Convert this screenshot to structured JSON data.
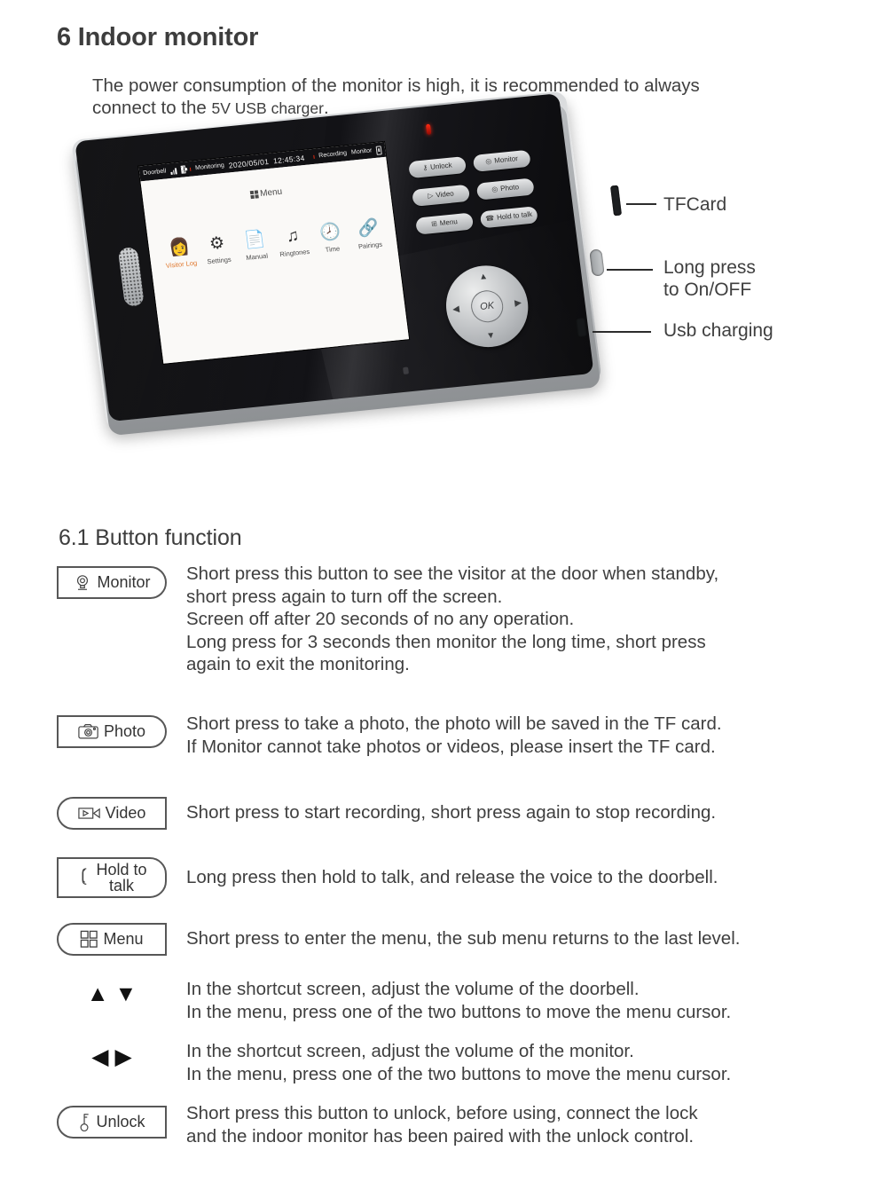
{
  "doc": {
    "section_number_title": "6 Indoor monitor",
    "intro_line1": "The power consumption of the monitor is high, it is recommended to always",
    "intro_line2_a": "connect to the ",
    "intro_line2_small": "5V USB",
    "intro_line2_b": " charger",
    "intro_line2_end": ".",
    "subsection_title": "6.1  Button function"
  },
  "device": {
    "callouts": [
      {
        "label": "TFCard"
      },
      {
        "label": "Long press\nto On/OFF"
      },
      {
        "label": "Usb charging"
      }
    ],
    "screen": {
      "status": {
        "name": "Doorbell",
        "monitoring": "Monitoring",
        "date": "2020/05/01",
        "time": "12:45:34",
        "recording": "Recording",
        "monitor": "Monitor",
        "card_icon": "sd-card-icon"
      },
      "menu_title": "Menu",
      "menu_items": [
        {
          "label": "Visitor Log",
          "icon": "visitor-person-icon",
          "glyph": "👩",
          "active": true
        },
        {
          "label": "Settings",
          "icon": "gear-icon",
          "glyph": "⚙",
          "active": false
        },
        {
          "label": "Manual",
          "icon": "document-icon",
          "glyph": "📄",
          "active": false
        },
        {
          "label": "Ringtones",
          "icon": "music-note-icon",
          "glyph": "♫",
          "active": false
        },
        {
          "label": "Time",
          "icon": "clock-icon",
          "glyph": "🕗",
          "active": false
        },
        {
          "label": "Pairings",
          "icon": "chain-link-icon",
          "glyph": "🔗",
          "active": false
        }
      ]
    },
    "keys": [
      {
        "label": "Unlock",
        "icon": "key-icon",
        "glyph": "⚷"
      },
      {
        "label": "Monitor",
        "icon": "camera-icon",
        "glyph": "◎"
      },
      {
        "label": "Video",
        "icon": "video-icon",
        "glyph": "▷"
      },
      {
        "label": "Photo",
        "icon": "photo-icon",
        "glyph": "◎"
      },
      {
        "label": "Menu",
        "icon": "grid-icon",
        "glyph": "⊞"
      },
      {
        "label": "Hold\nto talk",
        "icon": "handset-icon",
        "glyph": "☎"
      }
    ],
    "dpad": {
      "ok": "OK",
      "up": "▲",
      "down": "▼",
      "left": "◀",
      "right": "▶"
    }
  },
  "button_functions": [
    {
      "badge_label": "Monitor",
      "icon": "camera-monitor-icon",
      "shape": "r-right",
      "description": "Short press this button to see the visitor at the door when standby,\nshort press again to turn off  the screen.\nScreen off after 20 seconds of no any operation.\nLong press for 3 seconds then monitor the long time, short press\nagain to exit the monitoring."
    },
    {
      "badge_label": "Photo",
      "icon": "camera-icon",
      "shape": "r-right",
      "description": "Short press to take a photo, the photo will be saved in the TF card.\nIf Monitor cannot take photos or videos, please insert the TF card."
    },
    {
      "badge_label": "Video",
      "icon": "video-camera-icon",
      "shape": "r-left",
      "description": "Short press to start recording,  short press again to stop recording."
    },
    {
      "badge_label": "Hold to\ntalk",
      "icon": "phone-handset-icon",
      "shape": "r-right",
      "description": "Long  press then hold to talk, and release the voice to the doorbell."
    },
    {
      "badge_label": "Menu",
      "icon": "grid-menu-icon",
      "shape": "r-left",
      "description": "Short press to enter the menu, the sub menu returns to the last level."
    },
    {
      "badge_label": "",
      "icon": "up-down-arrows-icon",
      "shape": "arrows-vertical",
      "glyphs": "▲ ▼",
      "description": "In the shortcut screen, adjust the volume of the doorbell.\nIn the menu, press one of the two buttons to move the menu cursor."
    },
    {
      "badge_label": "",
      "icon": "left-right-arrows-icon",
      "shape": "arrows-horizontal",
      "glyphs": "◀ ▶",
      "description": "In the shortcut screen, adjust the volume of the monitor.\nIn the menu, press one of the two buttons to move the menu cursor."
    },
    {
      "badge_label": "Unlock",
      "icon": "key-icon",
      "shape": "r-left",
      "description": "Short press this button to unlock, before using, connect the lock\nand the indoor monitor has been paired with the unlock control."
    }
  ],
  "colors": {
    "text": "#3f3f3f",
    "heading": "#3d3d3d",
    "accent_orange": "#e07a31",
    "status_red": "#e02a12",
    "outline": "#575757"
  }
}
